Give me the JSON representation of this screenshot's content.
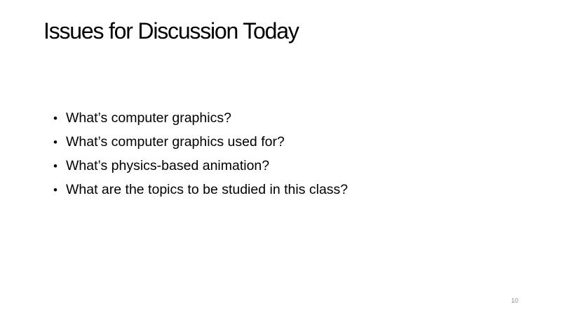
{
  "slide": {
    "title": "Issues for Discussion Today",
    "bullets": [
      "What’s computer graphics?",
      "What’s computer graphics used for?",
      "What’s physics-based animation?",
      "What are the topics to be studied in this class?"
    ],
    "bullet_glyph": "•",
    "page_number": "10"
  }
}
